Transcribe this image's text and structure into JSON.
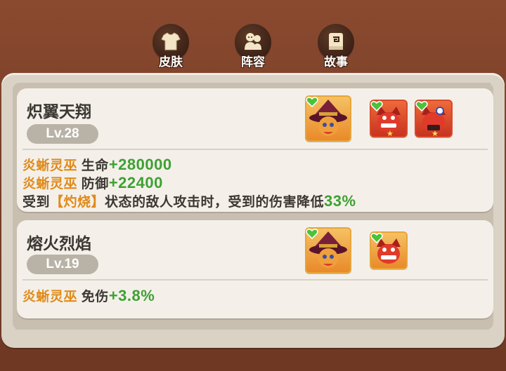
{
  "tabs": [
    {
      "label": "皮肤",
      "icon": "shirt-icon"
    },
    {
      "label": "阵容",
      "icon": "team-icon"
    },
    {
      "label": "故事",
      "icon": "book-icon"
    }
  ],
  "cards": [
    {
      "title": "炽翼天翔",
      "level": "Lv.28",
      "members": [
        "witch-hero-portrait",
        "red-dragon-portrait",
        "red-dragon-portrait"
      ],
      "bonuses": [
        {
          "hero": "炎蜥灵巫",
          "stat": "生命",
          "value": "+280000"
        },
        {
          "hero": "炎蜥灵巫",
          "stat": "防御",
          "value": "+22400"
        }
      ],
      "effect": {
        "prefix": "受到",
        "tag": "【灼烧】",
        "middle": "状态的敌人攻击时，受到的伤害降低",
        "value": "33%"
      }
    },
    {
      "title": "熔火烈焰",
      "level": "Lv.19",
      "members": [
        "witch-hero-portrait",
        "red-dragon-portrait"
      ],
      "bonuses": [
        {
          "hero": "炎蜥灵巫",
          "stat": "免伤",
          "value": "+3.8%"
        }
      ]
    }
  ],
  "colors": {
    "hero_name": "#e08a1a",
    "value_green": "#3da133",
    "heart": "#4cc23a"
  }
}
